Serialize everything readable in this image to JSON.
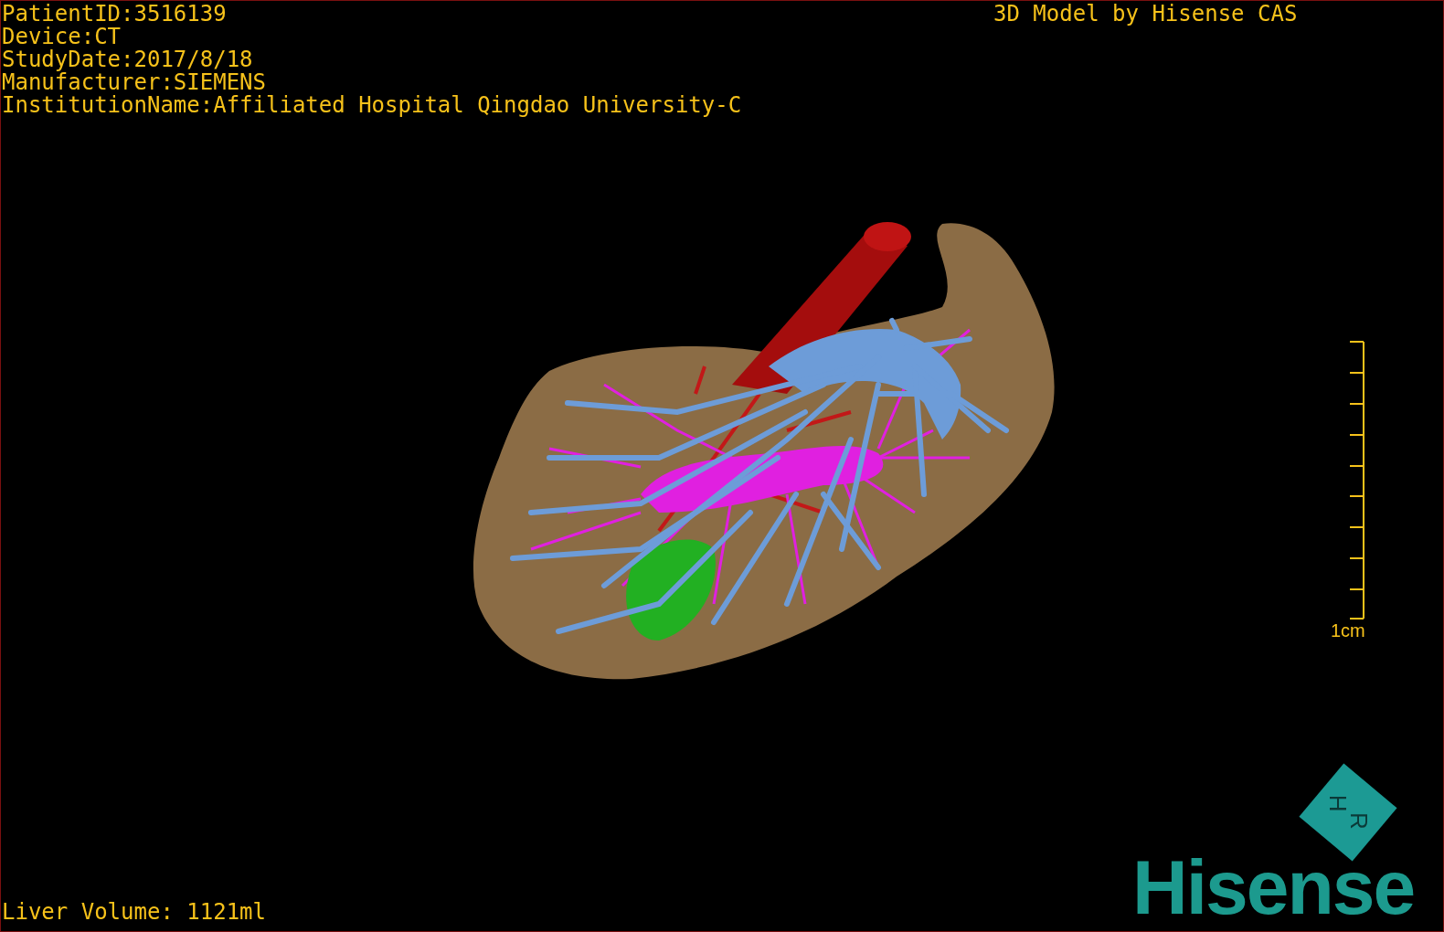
{
  "patient_info": [
    "PatientID:3516139",
    "Device:CT",
    "StudyDate:2017/8/18",
    "Manufacturer:SIEMENS",
    "InstitutionName:Affiliated Hospital Qingdao University-C"
  ],
  "title": "3D Model by Hisense CAS",
  "scale_bar": {
    "label": "1cm"
  },
  "liver_volume": "Liver Volume: 1121ml",
  "orientation_cube": {
    "faces": [
      "H",
      "R"
    ]
  },
  "logo": "Hisense"
}
